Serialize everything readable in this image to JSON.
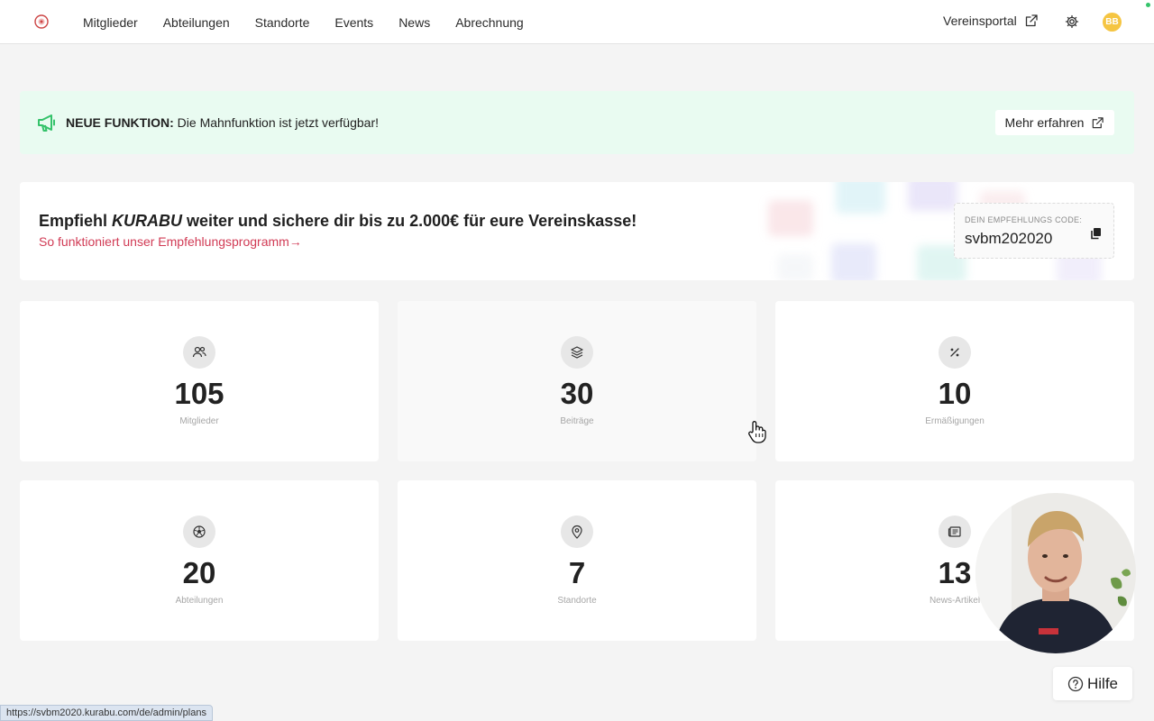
{
  "nav": {
    "items": [
      "Mitglieder",
      "Abteilungen",
      "Standorte",
      "Events",
      "News",
      "Abrechnung"
    ],
    "portal_label": "Vereinsportal",
    "avatar_initials": "BB"
  },
  "banner": {
    "label": "NEUE FUNKTION:",
    "text": "Die Mahnfunktion ist jetzt verfügbar!",
    "button": "Mehr erfahren"
  },
  "referral": {
    "title_prefix": "Empfiehl ",
    "brand": "KURABU",
    "title_suffix": " weiter und sichere dir bis zu 2.000€ für eure Vereinskasse!",
    "link": "So funktioniert unser Empfehlungsprogramm→",
    "code_label": "DEIN EMPFEHLUNGS CODE:",
    "code": "svbm202020"
  },
  "stats": [
    {
      "value": "105",
      "label": "Mitglieder",
      "icon": "members-icon"
    },
    {
      "value": "30",
      "label": "Beiträge",
      "icon": "layers-icon"
    },
    {
      "value": "10",
      "label": "Ermäßigungen",
      "icon": "percent-icon"
    },
    {
      "value": "20",
      "label": "Abteilungen",
      "icon": "ball-icon"
    },
    {
      "value": "7",
      "label": "Standorte",
      "icon": "location-pin-icon"
    },
    {
      "value": "13",
      "label": "News-Artikel",
      "icon": "newspaper-icon"
    }
  ],
  "help": {
    "label": "Hilfe"
  },
  "status_bar": {
    "url": "https://svbm2020.kurabu.com/de/admin/plans"
  },
  "colors": {
    "accent_red": "#d13b55",
    "banner_green": "#e9fbf1",
    "megaphone_green": "#34c26a",
    "avatar_yellow": "#f5c542"
  }
}
